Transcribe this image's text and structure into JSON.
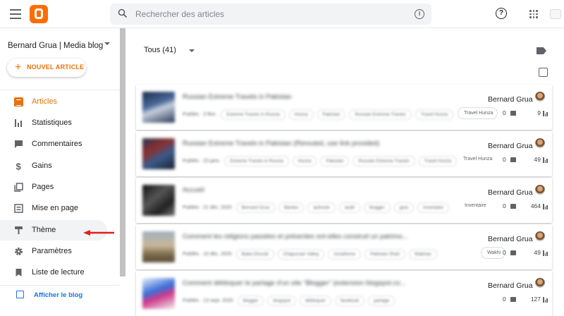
{
  "header": {
    "search_placeholder": "Rechercher des articles",
    "menu_icon": "hamburger-menu-icon",
    "logo_icon": "blogger-logo-icon",
    "help_icon": "help-icon",
    "apps_icon": "apps-grid-icon"
  },
  "sidebar": {
    "blog_name": "Bernard Grua | Media blog",
    "new_post_label": "NOUVEL ARTICLE",
    "items": [
      {
        "label": "Articles",
        "icon": "articles-icon",
        "active": true
      },
      {
        "label": "Statistiques",
        "icon": "stats-icon"
      },
      {
        "label": "Commentaires",
        "icon": "comments-icon"
      },
      {
        "label": "Gains",
        "icon": "dollar-icon"
      },
      {
        "label": "Pages",
        "icon": "pages-icon"
      },
      {
        "label": "Mise en page",
        "icon": "layout-icon"
      },
      {
        "label": "Thème",
        "icon": "theme-icon",
        "highlighted": true
      },
      {
        "label": "Paramètres",
        "icon": "settings-icon"
      },
      {
        "label": "Liste de lecture",
        "icon": "bookmark-icon"
      }
    ],
    "view_blog_label": "Afficher le blog"
  },
  "main": {
    "filter_label": "Tous (41)",
    "posts": [
      {
        "title": "Russian Extreme Travels in Pakistan",
        "published": "Publiés · 3 févr.",
        "tags": [
          "Extreme Travels in Russia",
          "Hunza",
          "Pakistan",
          "Russian Extreme Travels",
          "Travel Hunza"
        ],
        "chip": "Travel Hunza",
        "author": "Bernard Grua",
        "comments": "0",
        "views": "9"
      },
      {
        "title": "Russian Extreme Travels in Pakistan (Rerouted, use link provided)",
        "published": "Publiés · 23 janv.",
        "tags": [
          "Extreme Travels in Russia",
          "Hunza",
          "Pakistan",
          "Russian Extreme Travels",
          "Travel Hunza"
        ],
        "chip": "Travel Hunza",
        "author": "Bernard Grua",
        "comments": "0",
        "views": "49"
      },
      {
        "title": "Accueil",
        "published": "Publiés · 21 déc. 2020",
        "tags": [
          "Bernard Grua",
          "Bantes",
          "activiste",
          "audit",
          "blogger",
          "gras",
          "Inventaire"
        ],
        "chip": "Inventaire",
        "author": "Bernard Grua",
        "comments": "0",
        "views": "464"
      },
      {
        "title": "Comment les religions passées et présentes ont-elles construit un patrimo...",
        "published": "Publiés · 10 déc. 2020",
        "tags": [
          "Baba Ghundi",
          "Chapursan Valley",
          "Ismailisme",
          "Pakistan Shah",
          "Wakhan"
        ],
        "chip": "Wakhi",
        "author": "Bernard Grua",
        "comments": "0",
        "views": "49"
      },
      {
        "title": "Comment débloquer le partage d'un site \"Blogger\" (extension blogspot.co...",
        "published": "Publiés · 13 sept. 2020",
        "tags": [
          "blogger",
          "blogspot",
          "débloquer",
          "facebook",
          "partage"
        ],
        "chip": "",
        "author": "Bernard Grua",
        "comments": "0",
        "views": "127"
      }
    ]
  },
  "colors": {
    "accent": "#e8710a",
    "logo": "#ff6d00",
    "arrow": "#e02020",
    "link": "#1a73e8"
  }
}
